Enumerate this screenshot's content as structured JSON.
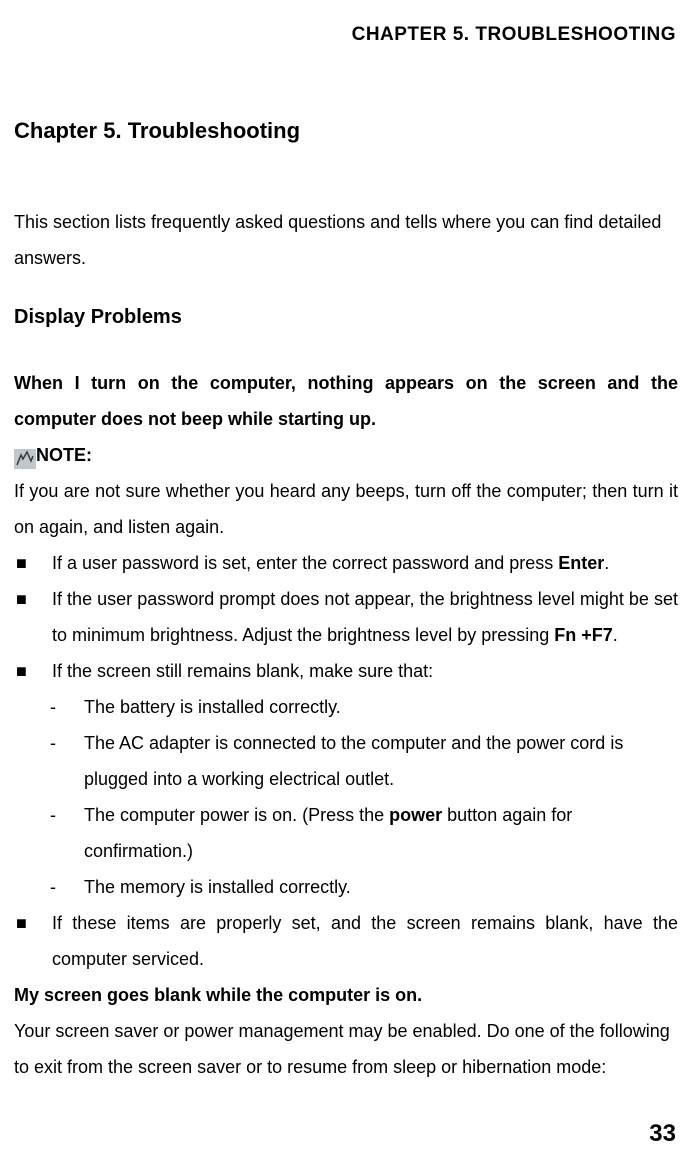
{
  "header": "CHAPTER  5.  TROUBLESHOOTING",
  "chapter_title": "Chapter 5. Troubleshooting",
  "intro": "This section lists frequently asked questions and tells where you can find detailed answers.",
  "section_heading": "Display Problems",
  "q1_heading": "When I turn on the computer, nothing appears on the screen and the computer does not beep while starting up.",
  "note_label": "NOTE:",
  "note_body": "If you are not sure whether you heard any beeps, turn off the computer; then turn it on again, and listen again.",
  "bullets": [
    {
      "pre": "If a user password is set, enter the correct password and press ",
      "bold": "Enter",
      "post": "."
    },
    {
      "pre": "If the user password prompt does not appear, the brightness level might be set to minimum brightness. Adjust the brightness level by pressing ",
      "bold": "Fn +F7",
      "post": "."
    },
    {
      "pre": "If the screen still remains blank, make sure that:",
      "bold": "",
      "post": ""
    }
  ],
  "sublist": [
    {
      "text": "The battery is installed correctly."
    },
    {
      "text": "The AC adapter is connected to the computer and the power cord is plugged into a working electrical outlet."
    },
    {
      "pre": "The computer power is on. (Press the ",
      "bold": "power",
      "post": " button again for confirmation.)"
    },
    {
      "text": "The memory is installed correctly."
    }
  ],
  "bullet_last": "If these items are properly set, and the screen remains blank, have the computer serviced.",
  "q2_heading": "My screen goes blank while the computer is on.",
  "q2_body": "Your screen saver or power management may be enabled. Do one of the following to exit from the screen saver or to resume from sleep or hibernation mode:",
  "page_number": "33"
}
